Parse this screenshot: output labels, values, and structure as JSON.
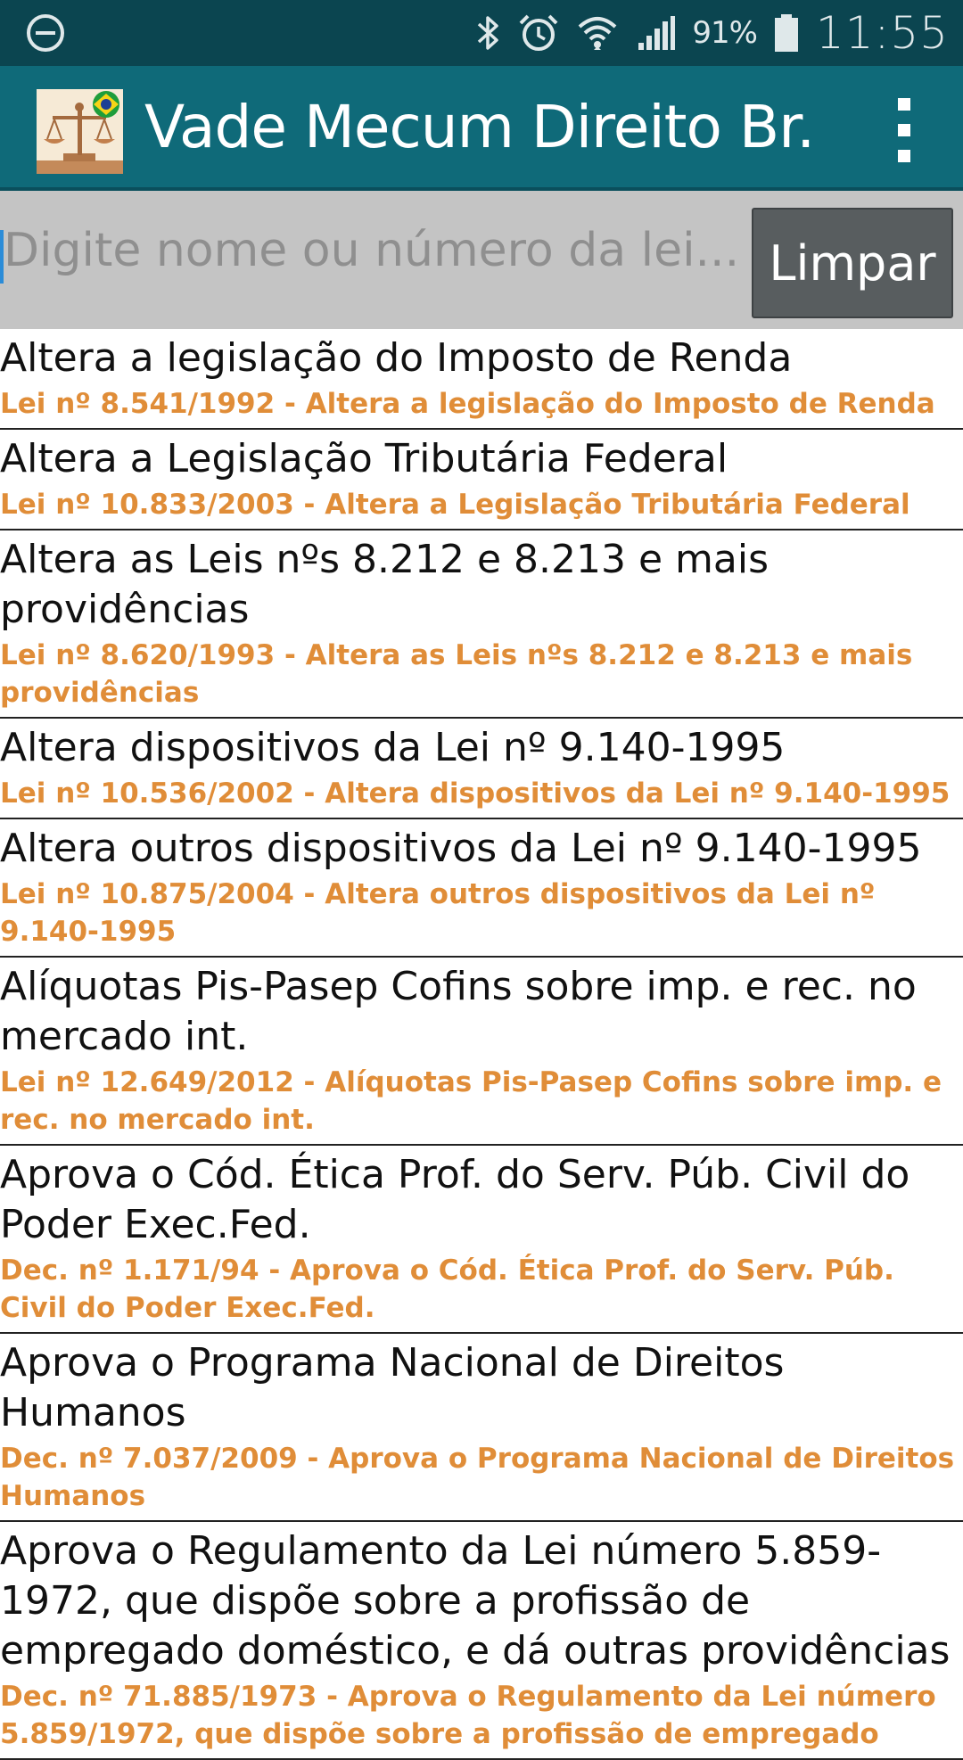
{
  "status_bar": {
    "battery_percent": "91%",
    "time": "11:55",
    "icons": [
      "minus-circle-icon",
      "bluetooth-icon",
      "alarm-icon",
      "wifi-icon",
      "signal-icon",
      "battery-icon"
    ]
  },
  "app_bar": {
    "title": "Vade Mecum Direito Br.",
    "logo": "scales-of-justice-brazil-flag-logo",
    "menu_icon": "overflow-menu-icon"
  },
  "search": {
    "placeholder": "Digite nome ou número da lei...",
    "value": "",
    "clear_label": "Limpar"
  },
  "laws": [
    {
      "title": "Altera a legislação do Imposto de Renda",
      "subtitle": "Lei nº 8.541/1992 - Altera a legislação do Imposto de Renda"
    },
    {
      "title": "Altera a Legislação Tributária Federal",
      "subtitle": "Lei nº 10.833/2003 - Altera a Legislação Tributária Federal"
    },
    {
      "title": "Altera as Leis nºs 8.212 e 8.213 e mais providências",
      "subtitle": "Lei nº 8.620/1993 - Altera as Leis nºs 8.212 e 8.213 e mais providências"
    },
    {
      "title": "Altera dispositivos da Lei nº 9.140-1995",
      "subtitle": "Lei nº 10.536/2002 - Altera dispositivos da Lei nº 9.140-1995"
    },
    {
      "title": "Altera outros dispositivos da Lei nº 9.140-1995",
      "subtitle": "Lei nº 10.875/2004 - Altera outros dispositivos da Lei nº 9.140-1995"
    },
    {
      "title": "Alíquotas Pis-Pasep Cofins sobre imp. e rec. no mercado int.",
      "subtitle": "Lei nº 12.649/2012 - Alíquotas Pis-Pasep Cofins sobre imp. e rec. no mercado int."
    },
    {
      "title": "Aprova o Cód. Ética Prof. do Serv. Púb. Civil do Poder Exec.Fed.",
      "subtitle": "Dec. nº 1.171/94 - Aprova o Cód. Ética Prof. do Serv. Púb. Civil do Poder Exec.Fed."
    },
    {
      "title": "Aprova o Programa Nacional de Direitos Humanos",
      "subtitle": "Dec. nº 7.037/2009 - Aprova o Programa Nacional de Direitos Humanos"
    },
    {
      "title": "Aprova o Regulamento da Lei número 5.859-1972, que dispõe sobre a profissão de empregado doméstico, e dá outras providências",
      "subtitle": "Dec. nº 71.885/1973 - Aprova o Regulamento da Lei número 5.859/1972, que dispõe sobre a profissão de empregado"
    }
  ]
}
